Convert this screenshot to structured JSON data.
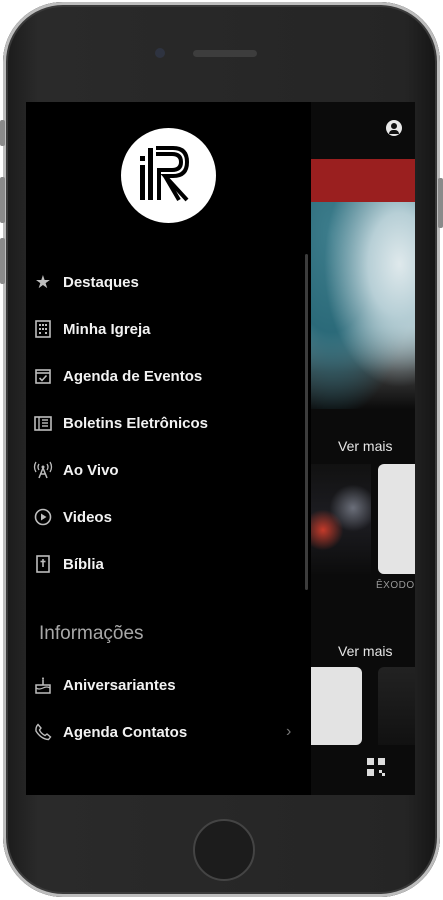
{
  "drawer": {
    "items": [
      {
        "label": "Destaques",
        "icon": "star-icon"
      },
      {
        "label": "Minha Igreja",
        "icon": "building-icon"
      },
      {
        "label": "Agenda de Eventos",
        "icon": "calendar-check-icon"
      },
      {
        "label": "Boletins Eletrônicos",
        "icon": "newspaper-icon"
      },
      {
        "label": "Ao Vivo",
        "icon": "broadcast-icon"
      },
      {
        "label": "Videos",
        "icon": "play-circle-icon"
      },
      {
        "label": "Bíblia",
        "icon": "bible-icon"
      }
    ],
    "section_info": "Informações",
    "info_items": [
      {
        "label": "Aniversariantes",
        "icon": "cake-icon"
      },
      {
        "label": "Agenda Contatos",
        "icon": "phone-icon"
      }
    ]
  },
  "content": {
    "ver_mais_1": "Ver mais",
    "ver_mais_2": "Ver mais",
    "thumb_caption": "ÊXODO"
  },
  "colors": {
    "accent_red": "#9a1f1f",
    "drawer_bg": "#000000"
  }
}
